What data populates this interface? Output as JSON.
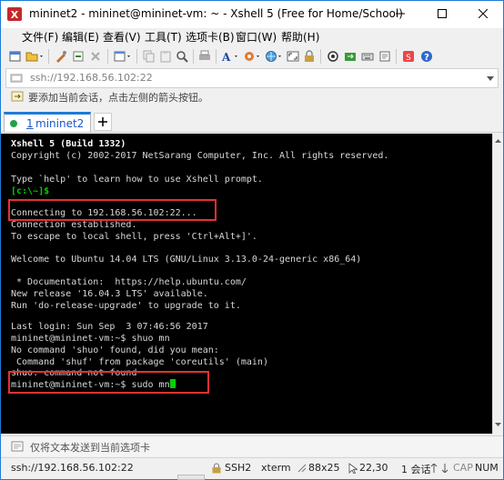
{
  "window": {
    "title": "mininet2 - mininet@mininet-vm: ~ - Xshell 5 (Free for Home/School)",
    "accent_color": "#1e7bd7",
    "highlight_color": "#e8312f"
  },
  "menu": {
    "items": [
      "文件(F)",
      "编辑(E)",
      "查看(V)",
      "工具(T)",
      "选项卡(B)",
      "窗口(W)",
      "帮助(H)"
    ]
  },
  "toolbar": {
    "icons": [
      "new-session-icon",
      "open-folder-icon",
      "properties-icon",
      "connect-icon",
      "disconnect-icon",
      "new-window-icon",
      "copy-icon",
      "paste-icon",
      "find-icon",
      "print-icon",
      "font-icon",
      "globe-icon",
      "lock-icon",
      "keyboard-icon",
      "compose-icon",
      "tunnel-icon",
      "transfer-icon",
      "script-icon",
      "help-icon"
    ]
  },
  "address": {
    "value": "ssh://192.168.56.102:22"
  },
  "hint": {
    "text": "要添加当前会话，点击左侧的箭头按钮。"
  },
  "tabs": [
    {
      "number": "1",
      "label": "mininet2"
    }
  ],
  "terminal": {
    "lines": [
      "Xshell 5 (Build 1332)",
      "Copyright (c) 2002-2017 NetSarang Computer, Inc. All rights reserved.",
      "",
      "Type `help' to learn how to use Xshell prompt.",
      "[c:\\~]$",
      "",
      "Connecting to 192.168.56.102:22...",
      "Connection established.",
      "To escape to local shell, press 'Ctrl+Alt+]'.",
      "",
      "Welcome to Ubuntu 14.04 LTS (GNU/Linux 3.13.0-24-generic x86_64)",
      "",
      " * Documentation:  https://help.ubuntu.com/",
      "New release '16.04.3 LTS' available.",
      "Run 'do-release-upgrade' to upgrade to it.",
      "",
      "Last login: Sun Sep  3 07:46:56 2017",
      "mininet@mininet-vm:~$ shuo mn",
      "No command 'shuo' found, did you mean:",
      " Command 'shuf' from package 'coreutils' (main)",
      "shuo: command not found",
      "mininet@mininet-vm:~$ sudo mn"
    ]
  },
  "compose": {
    "placeholder": "仅将文本发送到当前选项卡"
  },
  "status": {
    "address": "ssh://192.168.56.102:22",
    "protocol": "SSH2",
    "terminal_type": "xterm",
    "size": "88x25",
    "cursor_pos": "22,30",
    "sessions": "1 会话",
    "cap": "CAP",
    "num": "NUM"
  }
}
